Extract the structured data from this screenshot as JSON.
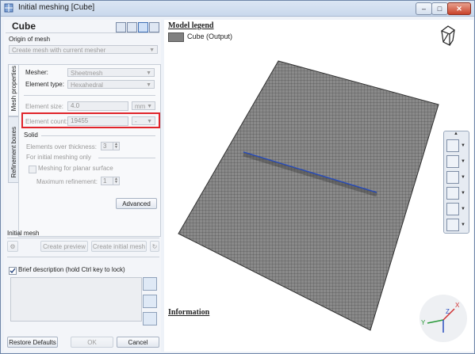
{
  "window": {
    "title": "Initial meshing [Cube]",
    "controls": [
      "–",
      "□",
      "✕"
    ]
  },
  "left": {
    "name": "Cube",
    "origin_header": "Origin of mesh",
    "origin_select": "Create mesh with current mesher",
    "tabs": [
      "Mesh properties",
      "Refinement boxes"
    ],
    "mesher_label": "Mesher:",
    "mesher_value": "Sheetmesh",
    "element_type_label": "Element type:",
    "element_type_value": "Hexahedral",
    "element_size_label": "Element size:",
    "element_size_value": "4.0",
    "element_size_unit": "mm",
    "element_count_label": "Element count:",
    "element_count_value": "19455",
    "element_count_unit": "-",
    "solid_header": "Solid",
    "elements_thickness_label": "Elements over thickness:",
    "elements_thickness_value": "3",
    "initial_only_label": "For initial meshing only",
    "planar_label": "Meshing for planar surface",
    "max_ref_label": "Maximum refinement:",
    "max_ref_value": "1",
    "advanced_btn": "Advanced",
    "initial_mesh_header": "Initial mesh",
    "create_preview_btn": "Create preview",
    "create_initial_btn": "Create initial mesh",
    "brief_label": "Brief description (hold Ctrl key to lock)",
    "restore_btn": "Restore Defaults",
    "ok_btn": "OK",
    "cancel_btn": "Cancel"
  },
  "view": {
    "legend_title": "Model legend",
    "legend_item": "Cube (Output)",
    "info_title": "Information",
    "axes": {
      "x": "X",
      "y": "Y",
      "z": "Z"
    }
  },
  "colors": {
    "highlight": "#e0242b",
    "mesh": "#7b7b7b",
    "seam": "#2a4fbf"
  }
}
